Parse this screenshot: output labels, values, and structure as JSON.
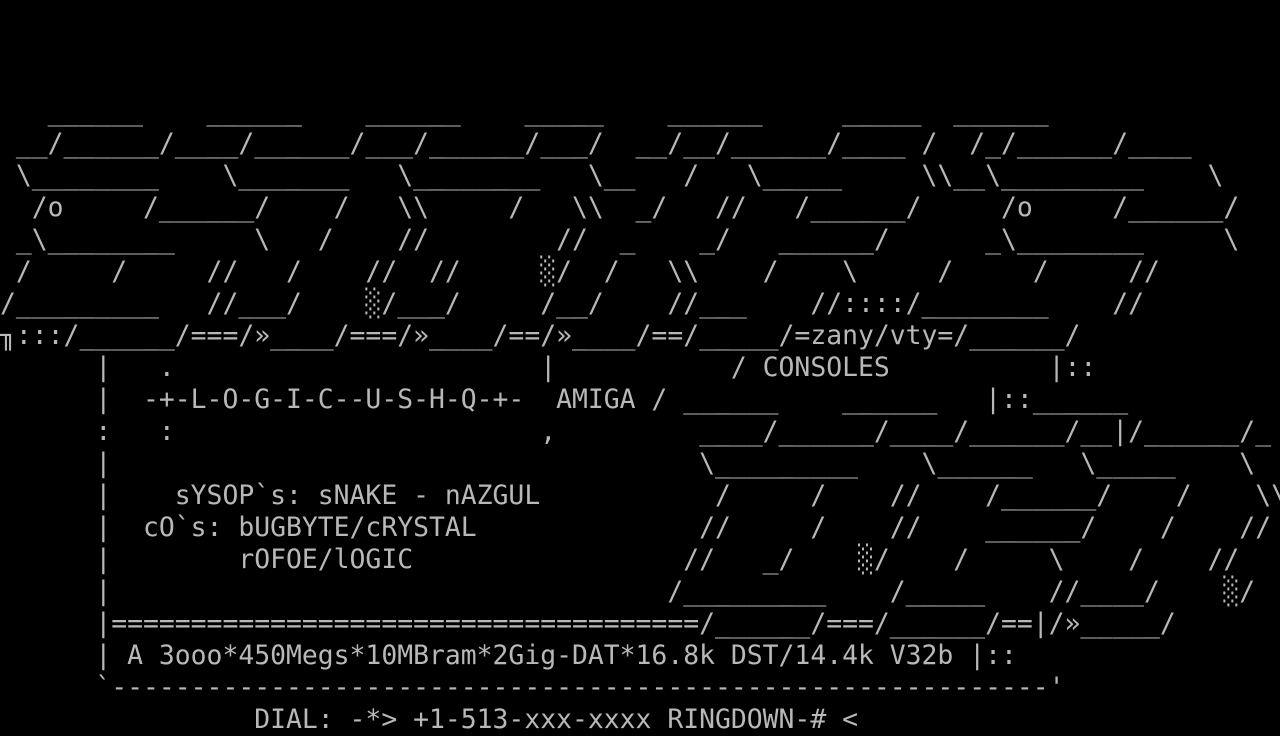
{
  "colors": {
    "background": "#000000",
    "foreground": "#b8b8b8"
  },
  "screen": {
    "lines": [
      "",
      "",
      "",
      "   ______    ______    ______    _____    ______     _____  ______",
      " __/______/____/______/___/______/___/  __/__/______/____ /  /_/______/____",
      " \\________    \\_______   \\________   \\__   /   \\_____     \\\\__\\_________    \\",
      "  /o     /______/    /   \\\\     /   \\\\  _/   //   /______/     /o     /______/",
      " _\\________     \\   /    //        //  _    _/   ______/      _\\________     \\",
      " /     /     //   /    //  //     ░/  /   \\\\    /    \\     /     /     //",
      "/_________   //___/    ░/___/     /__/    //___    //::::/________    //",
      "╖:::/______/===/»____/===/»____/==/»____/==/_____/=zany/vty=/______/",
      "      |   .                       |           / CONSOLES          |::",
      "      |  -+-L-O-G-I-C--U-S-H-Q-+-  AMIGA / ______    ______   |::______",
      "      :   :                       ,         ____/______/____/______/__|/______/_",
      "      |                                     \\_________    \\______   \\_____    \\",
      "      |    sYSOP`s: sNAKE - nAZGUL           /     /    //    /______/    /    \\\\",
      "      |  cO`s: bUGBYTE/cRYSTAL              //     /    //    ______/    /    //",
      "      |        rOFOE/lOGIC                 //   _/    ░/    /     \\    /    //",
      "      |                                   /_________    /_____    //____/    ░/",
      "      |=====================================/______/===/______/==|/»_____/",
      "      | A 3ooo*450Megs*10MBram*2Gig-DAT*16.8k DST/14.4k V32b |::",
      "      `-----------------------------------------------------------'",
      "                DIAL: -*> +1-513-xxx-xxxx RINGDOWN-# <"
    ]
  }
}
